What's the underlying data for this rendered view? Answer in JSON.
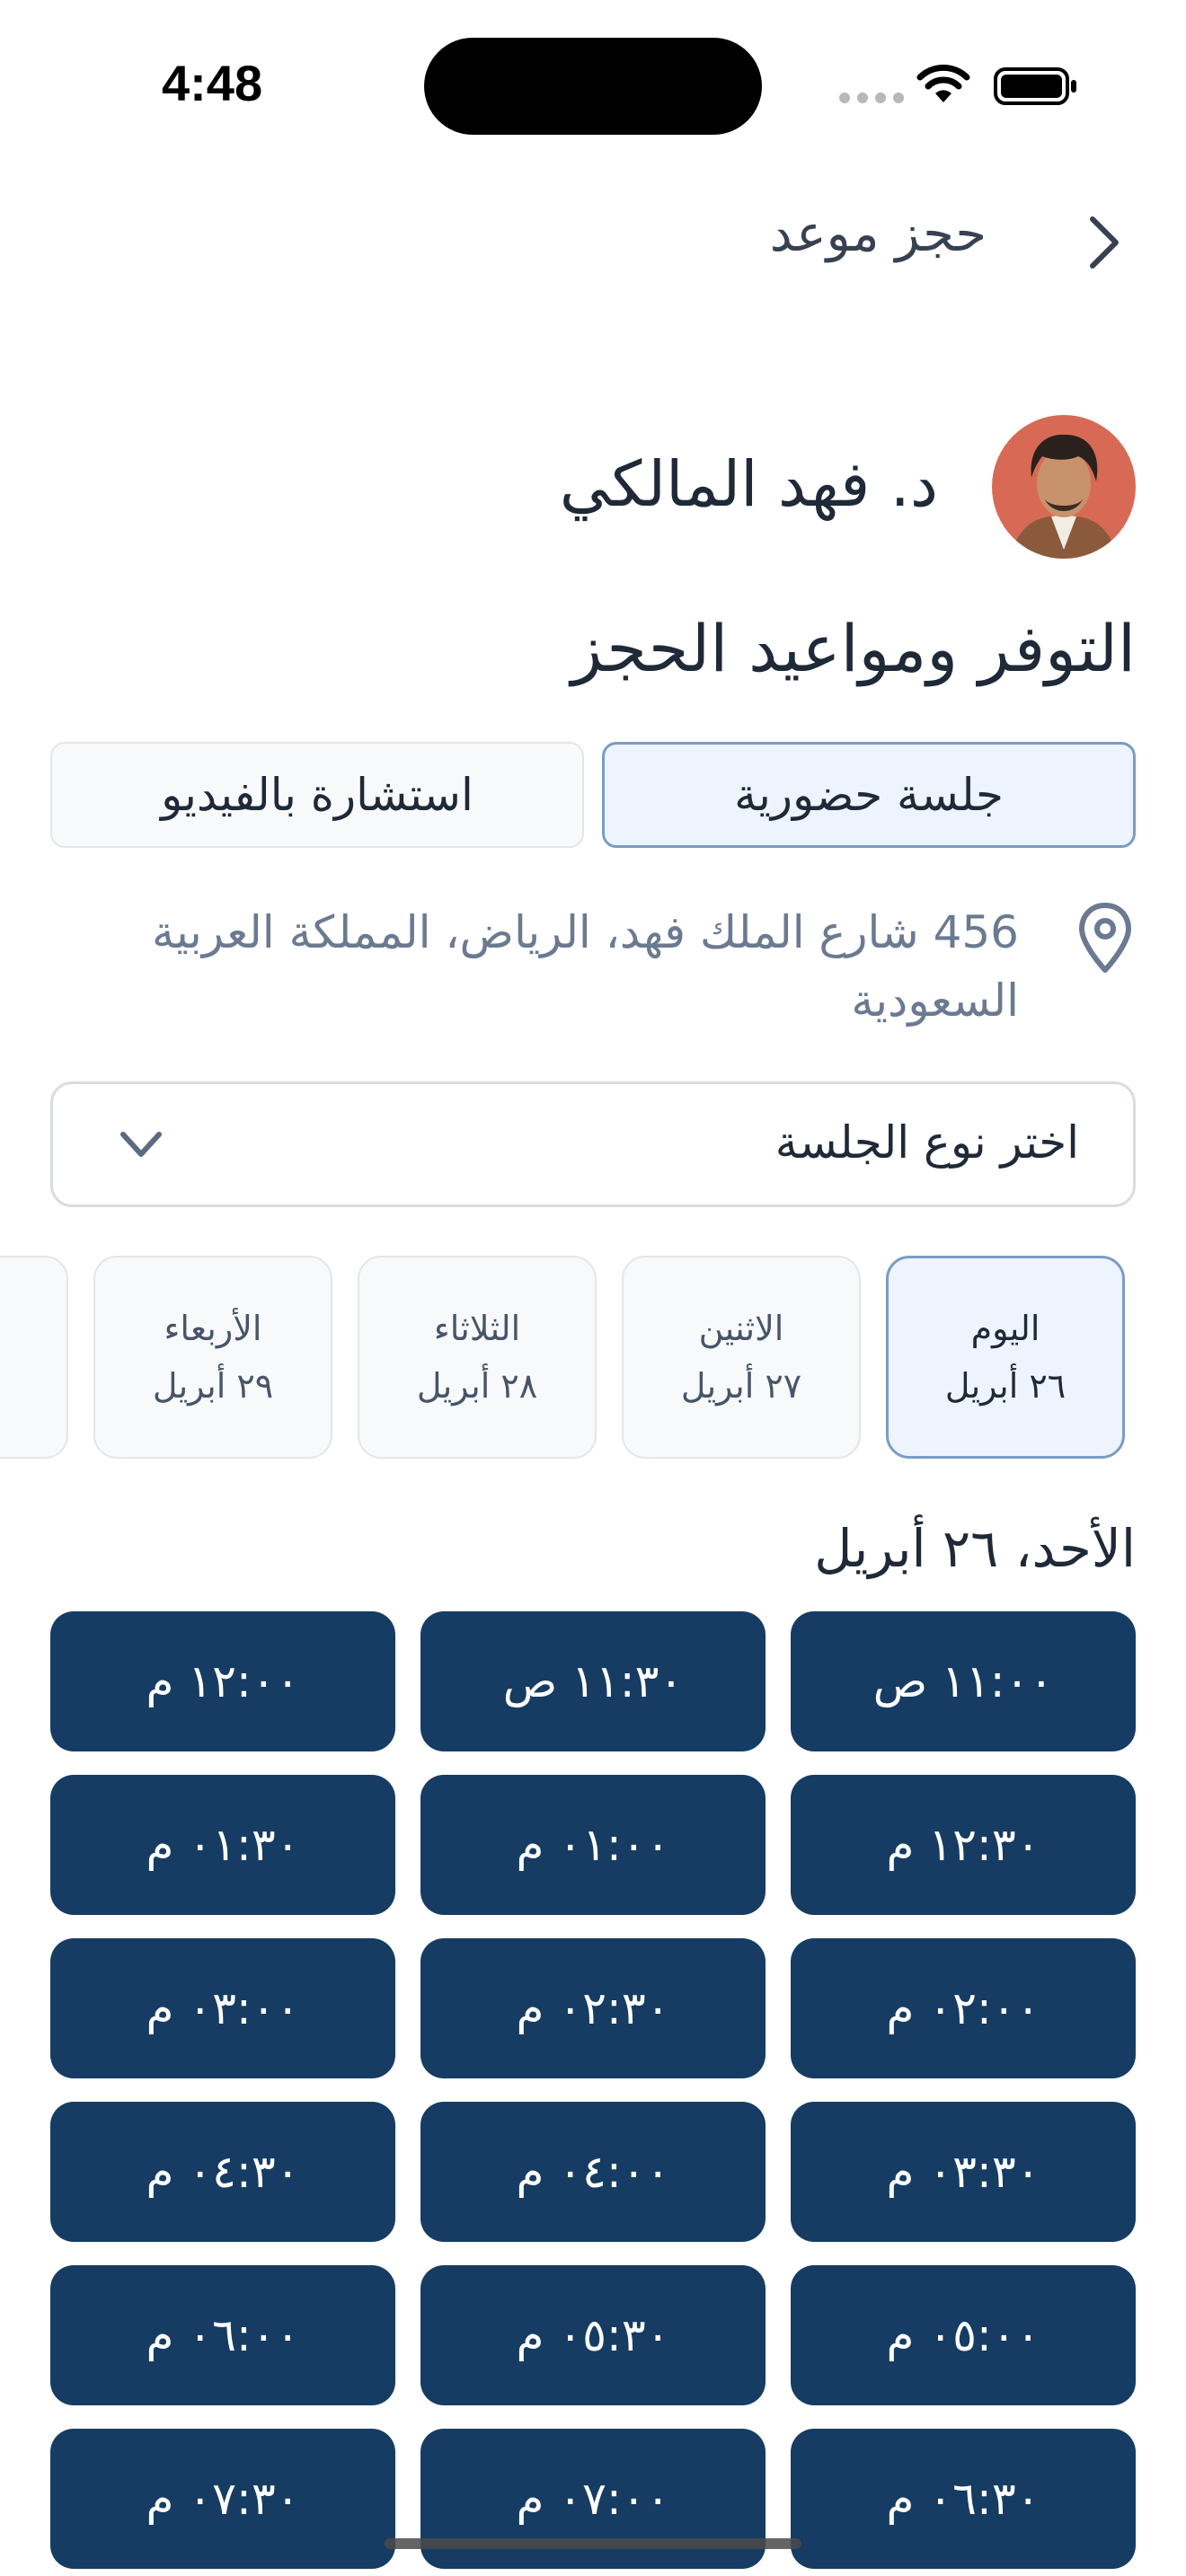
{
  "status_bar": {
    "time": "4:48"
  },
  "header": {
    "title": "حجز موعد"
  },
  "doctor": {
    "name": "د. فهد المالكي"
  },
  "section_title": "التوفر ومواعيد الحجز",
  "tabs": [
    {
      "label": "جلسة حضورية",
      "active": true
    },
    {
      "label": "استشارة بالفيديو",
      "active": false
    }
  ],
  "address": "456 شارع الملك فهد، الرياض، المملكة العربية السعودية",
  "session_select": {
    "label": "اختر نوع الجلسة"
  },
  "dates": [
    {
      "label": "اليوم",
      "date": "٢٦ أبريل",
      "selected": true
    },
    {
      "label": "الاثنين",
      "date": "٢٧ أبريل",
      "selected": false
    },
    {
      "label": "الثلاثاء",
      "date": "٢٨ أبريل",
      "selected": false
    },
    {
      "label": "الأربعاء",
      "date": "٢٩ أبريل",
      "selected": false
    }
  ],
  "day_heading": "الأحد، ٢٦ أبريل",
  "slots": [
    "١١:٠٠ ص",
    "١١:٣٠ ص",
    "١٢:٠٠ م",
    "١٢:٣٠ م",
    "٠١:٠٠ م",
    "٠١:٣٠ م",
    "٠٢:٠٠ م",
    "٠٢:٣٠ م",
    "٠٣:٠٠ م",
    "٠٣:٣٠ م",
    "٠٤:٠٠ م",
    "٠٤:٣٠ م",
    "٠٥:٠٠ م",
    "٠٥:٣٠ م",
    "٠٦:٠٠ م",
    "٠٦:٣٠ م",
    "٠٧:٠٠ م",
    "٠٧:٣٠ م"
  ],
  "colors": {
    "slot_bg": "#163c63",
    "selected_bg": "#eef4fd",
    "selected_border": "#7a9cc6",
    "address_text": "#6b7a90"
  }
}
